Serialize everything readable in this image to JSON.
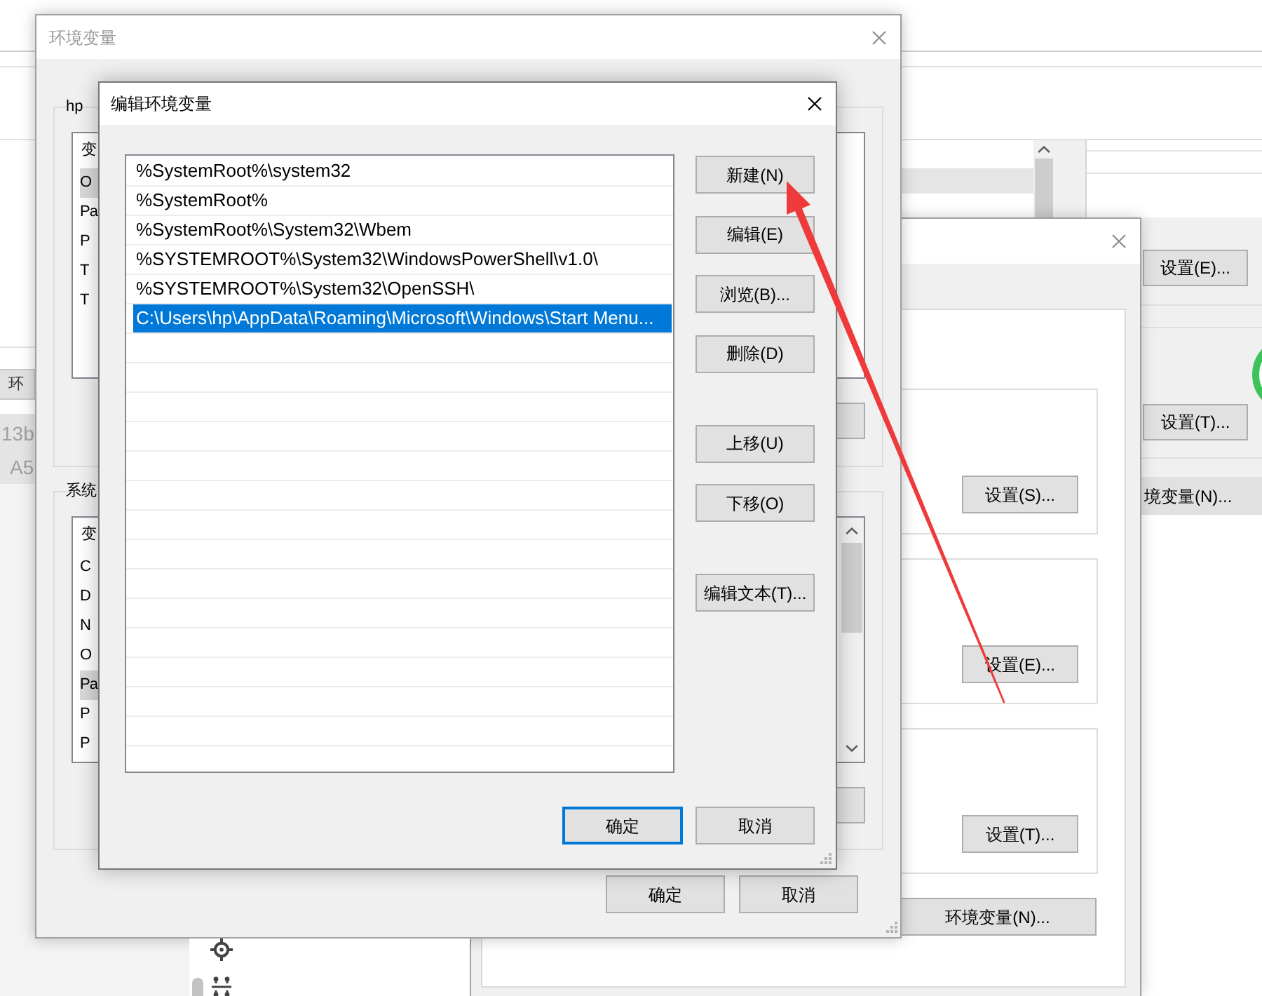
{
  "back_left_window": {
    "button": "环",
    "values": [
      "13b",
      "A5"
    ]
  },
  "back_right_window": {
    "buttons": [
      "设置(E)...",
      "设置(T)...",
      "境变量(N)..."
    ]
  },
  "system_properties_dialog": {
    "active": false,
    "group_buttons": [
      "设置(S)...",
      "设置(E)...",
      "设置(T)..."
    ],
    "env_button": "环境变量(N)..."
  },
  "env_vars_dialog": {
    "title": "环境变量",
    "active": false,
    "user_group": {
      "label": "hp",
      "header": "变",
      "rows": [
        {
          "text": "O",
          "selected": true
        },
        {
          "text": "Pa",
          "selected": false
        },
        {
          "text": "P",
          "selected": false
        },
        {
          "text": "T",
          "selected": false
        },
        {
          "text": "T",
          "selected": false
        }
      ]
    },
    "system_group": {
      "label": "系统",
      "header": "变",
      "rows": [
        {
          "text": "C",
          "selected": false
        },
        {
          "text": "D",
          "selected": false
        },
        {
          "text": "N",
          "selected": false
        },
        {
          "text": "O",
          "selected": false
        },
        {
          "text": "Pa",
          "selected": true
        },
        {
          "text": "P",
          "selected": false
        },
        {
          "text": "P",
          "selected": false
        }
      ]
    },
    "buttons": [
      "确定",
      "取消"
    ]
  },
  "edit_dialog": {
    "title": "编辑环境变量",
    "active": true,
    "entries": [
      {
        "text": "%SystemRoot%\\system32",
        "selected": false
      },
      {
        "text": "%SystemRoot%",
        "selected": false
      },
      {
        "text": "%SystemRoot%\\System32\\Wbem",
        "selected": false
      },
      {
        "text": "%SYSTEMROOT%\\System32\\WindowsPowerShell\\v1.0\\",
        "selected": false
      },
      {
        "text": "%SYSTEMROOT%\\System32\\OpenSSH\\",
        "selected": false
      },
      {
        "text": "C:\\Users\\hp\\AppData\\Roaming\\Microsoft\\Windows\\Start Menu...",
        "selected": true
      }
    ],
    "button_groups": [
      [
        "新建(N)",
        "编辑(E)",
        "浏览(B)...",
        "删除(D)"
      ],
      [
        "上移(U)",
        "下移(O)"
      ],
      [
        "编辑文本(T)..."
      ]
    ],
    "footer_buttons": [
      {
        "label": "确定",
        "default": true
      },
      {
        "label": "取消",
        "default": false
      }
    ]
  }
}
